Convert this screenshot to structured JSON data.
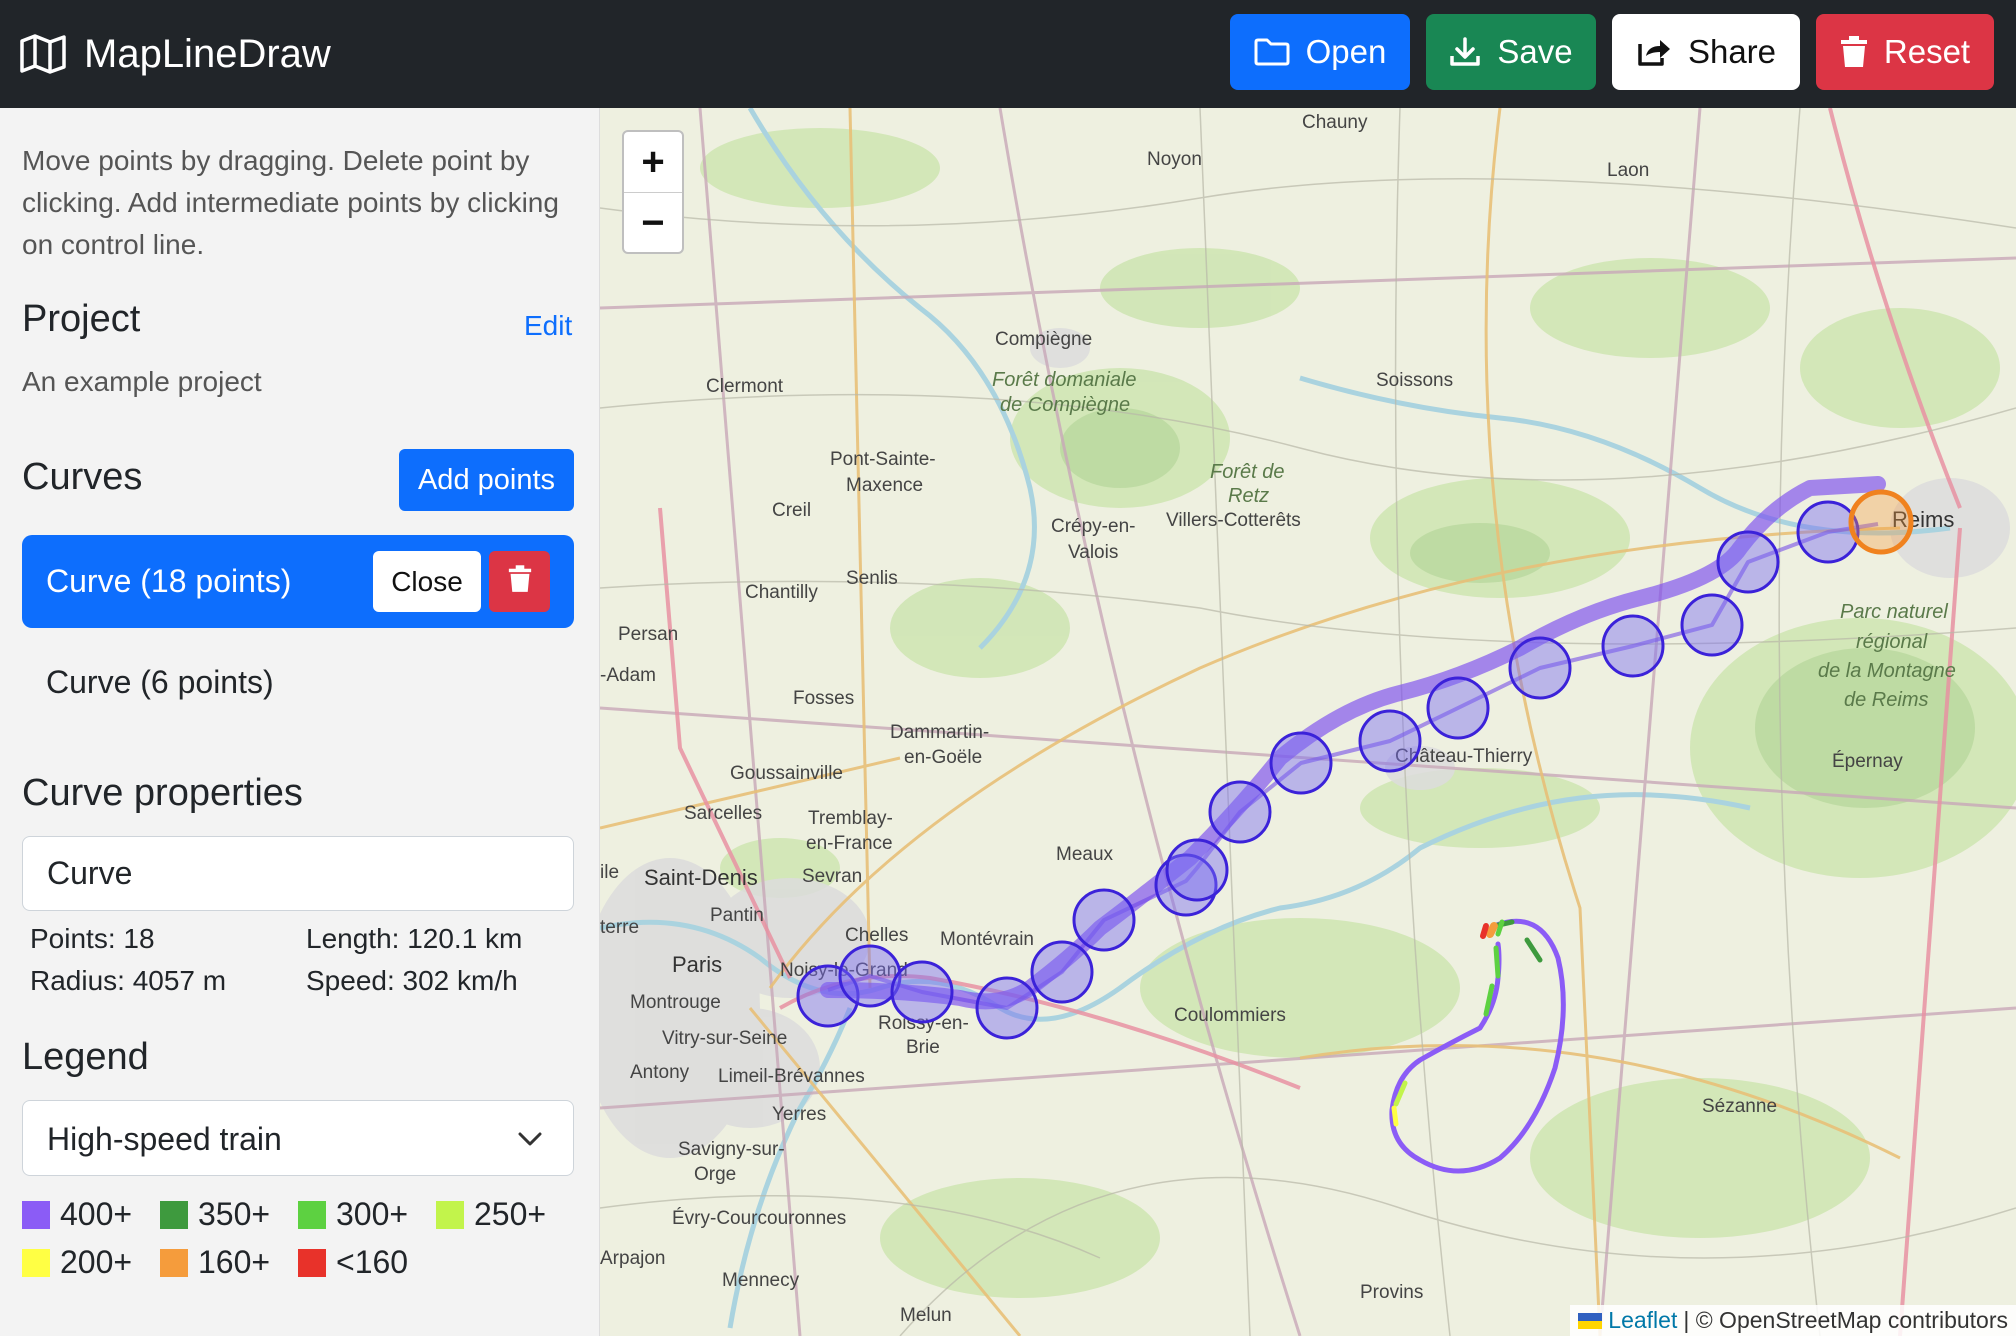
{
  "app": {
    "title": "MapLineDraw"
  },
  "toolbar": {
    "open_label": "Open",
    "save_label": "Save",
    "share_label": "Share",
    "reset_label": "Reset"
  },
  "sidebar": {
    "help_text": "Move points by dragging. Delete point by clicking. Add intermediate points by clicking on control line.",
    "project": {
      "heading": "Project",
      "edit_label": "Edit",
      "description": "An example project"
    },
    "curves": {
      "heading": "Curves",
      "add_label": "Add points",
      "items": [
        {
          "label": "Curve (18 points)",
          "active": true,
          "close_label": "Close"
        },
        {
          "label": "Curve (6 points)",
          "active": false
        }
      ]
    },
    "properties": {
      "heading": "Curve properties",
      "name_value": "Curve",
      "points": "Points: 18",
      "length": "Length: 120.1 km",
      "radius": "Radius: 4057 m",
      "speed": "Speed: 302 km/h"
    },
    "legend": {
      "heading": "Legend",
      "selected": "High-speed train",
      "items": [
        {
          "label": "400+",
          "color": "#8b5cf6"
        },
        {
          "label": "350+",
          "color": "#3e9a3e"
        },
        {
          "label": "300+",
          "color": "#5dd141"
        },
        {
          "label": "250+",
          "color": "#c2f44b"
        },
        {
          "label": "200+",
          "color": "#ffff44"
        },
        {
          "label": "160+",
          "color": "#f59c3c"
        },
        {
          "label": "<160",
          "color": "#e8322a"
        }
      ]
    }
  },
  "map": {
    "zoom_in": "+",
    "zoom_out": "−",
    "attribution_link": "Leaflet",
    "attribution_text": "| © OpenStreetMap contributors",
    "labels": {
      "chauny": "Chauny",
      "noyon": "Noyon",
      "laon": "Laon",
      "compiegne": "Compiègne",
      "foret_compiegne_1": "Forêt domaniale",
      "foret_compiegne_2": "de Compiègne",
      "clermont": "Clermont",
      "soissons": "Soissons",
      "pont1": "Pont-Sainte-",
      "pont2": "Maxence",
      "foret_retz_1": "Forêt de",
      "foret_retz_2": "Retz",
      "creil": "Creil",
      "crepy1": "Crépy-en-",
      "crepy2": "Valois",
      "villers": "Villers-Cotterêts",
      "reims": "Reims",
      "chantilly": "Chantilly",
      "senlis": "Senlis",
      "persan": "Persan",
      "adam": "-Adam",
      "parc1": "Parc naturel",
      "parc2": "régional",
      "parc3": "de la Montagne",
      "parc4": "de Reims",
      "fosses": "Fosses",
      "dammartin1": "Dammartin-",
      "dammartin2": "en-Goële",
      "chateau": "Château-Thierry",
      "epernay": "Épernay",
      "goussainville": "Goussainville",
      "sarcelles": "Sarcelles",
      "tremblay1": "Tremblay-",
      "tremblay2": "en-France",
      "meaux": "Meaux",
      "ile": "ile",
      "saintdenis": "Saint-Denis",
      "sevran": "Sevran",
      "pantin": "Pantin",
      "terre": "terre",
      "chelles": "Chelles",
      "montevrain": "Montévrain",
      "paris": "Paris",
      "noisy": "Noisy-le-Grand",
      "montrouge": "Montrouge",
      "roissy1": "Roissy-en-",
      "roissy2": "Brie",
      "coulommiers": "Coulommiers",
      "vitry": "Vitry-sur-Seine",
      "antony": "Antony",
      "limeil": "Limeil-Brévannes",
      "yerres": "Yerres",
      "sezanne": "Sézanne",
      "savigny1": "Savigny-sur-",
      "savigny2": "Orge",
      "evry": "Évry-Courcouronnes",
      "arpajon": "Arpajon",
      "mennecy": "Mennecy",
      "provins": "Provins",
      "melun": "Melun"
    }
  }
}
